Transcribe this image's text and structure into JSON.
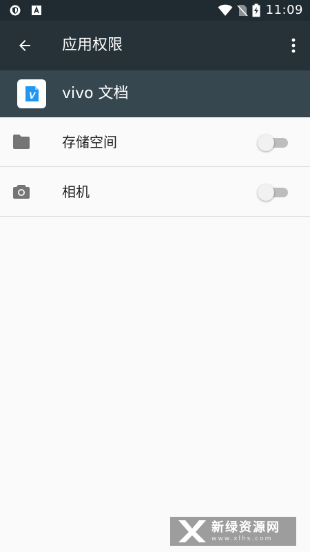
{
  "status_bar": {
    "time": "11:09",
    "icons": [
      "vpn-shield-icon",
      "a-notification-icon",
      "wifi-icon",
      "no-sim-icon",
      "battery-charging-icon"
    ]
  },
  "app_bar": {
    "title": "应用权限",
    "back_icon": "arrow-back-icon",
    "menu_icon": "more-vert-icon"
  },
  "app_header": {
    "name": "vivo 文档",
    "icon": "vivo-docs-app-icon",
    "icon_letter": "V"
  },
  "permissions": [
    {
      "label": "存储空间",
      "icon": "folder-icon",
      "enabled": false
    },
    {
      "label": "相机",
      "icon": "camera-icon",
      "enabled": false
    }
  ],
  "watermark": {
    "title": "新绿资源网",
    "url": "www.xlhs.com"
  },
  "colors": {
    "status_bar_bg": "#1f2b31",
    "app_bar_bg": "#263238",
    "header_bg": "#37474f",
    "background": "#fafafa",
    "app_icon_blue": "#2196f3"
  }
}
